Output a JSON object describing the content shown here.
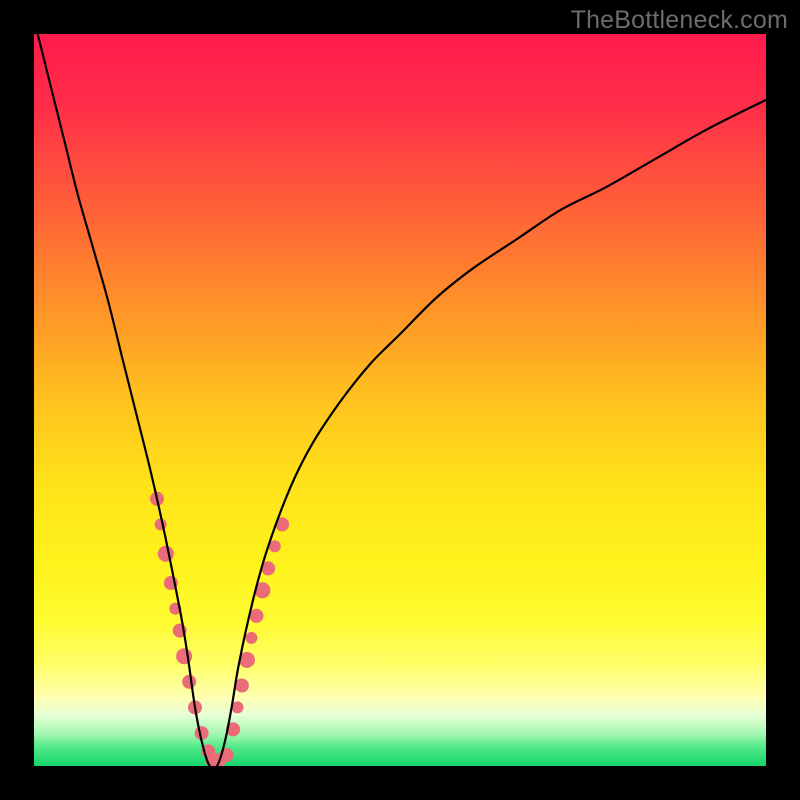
{
  "watermark": "TheBottleneck.com",
  "gradient": {
    "stops": [
      {
        "offset": 0.0,
        "color": "#ff1a4c"
      },
      {
        "offset": 0.1,
        "color": "#ff2e49"
      },
      {
        "offset": 0.22,
        "color": "#ff5a3a"
      },
      {
        "offset": 0.35,
        "color": "#ff8a2b"
      },
      {
        "offset": 0.5,
        "color": "#ffc21f"
      },
      {
        "offset": 0.62,
        "color": "#ffe41a"
      },
      {
        "offset": 0.72,
        "color": "#fff21c"
      },
      {
        "offset": 0.8,
        "color": "#fffb30"
      },
      {
        "offset": 0.86,
        "color": "#ffff66"
      },
      {
        "offset": 0.905,
        "color": "#ffffb0"
      },
      {
        "offset": 0.93,
        "color": "#e8ffd8"
      },
      {
        "offset": 0.955,
        "color": "#a8f8b2"
      },
      {
        "offset": 0.975,
        "color": "#4fe887"
      },
      {
        "offset": 1.0,
        "color": "#16d56a"
      }
    ]
  },
  "chart_data": {
    "type": "line",
    "title": "",
    "xlabel": "",
    "ylabel": "",
    "xlim": [
      0,
      100
    ],
    "ylim": [
      0,
      100
    ],
    "series": [
      {
        "name": "curve",
        "x": [
          0,
          2,
          4,
          6,
          8,
          10,
          12,
          14,
          16,
          18,
          20,
          21,
          22,
          23,
          24,
          25,
          26,
          27,
          28,
          30,
          32,
          35,
          38,
          42,
          46,
          50,
          55,
          60,
          66,
          72,
          78,
          85,
          92,
          100
        ],
        "y": [
          102,
          94,
          86,
          78,
          71,
          64,
          56,
          48,
          40,
          31,
          21,
          15,
          8,
          3,
          0,
          0,
          3,
          8,
          14,
          23,
          30,
          38,
          44,
          50,
          55,
          59,
          64,
          68,
          72,
          76,
          79,
          83,
          87,
          91
        ]
      }
    ],
    "dot_clusters": [
      {
        "name": "left-cluster",
        "color": "#ea6c78",
        "points": [
          {
            "x": 16.8,
            "y": 36.5,
            "r": 7
          },
          {
            "x": 17.3,
            "y": 33.0,
            "r": 6
          },
          {
            "x": 18.0,
            "y": 29.0,
            "r": 8
          },
          {
            "x": 18.7,
            "y": 25.0,
            "r": 7
          },
          {
            "x": 19.3,
            "y": 21.5,
            "r": 6
          },
          {
            "x": 19.9,
            "y": 18.5,
            "r": 7
          },
          {
            "x": 20.5,
            "y": 15.0,
            "r": 8
          },
          {
            "x": 21.2,
            "y": 11.5,
            "r": 7
          },
          {
            "x": 22.0,
            "y": 8.0,
            "r": 7
          },
          {
            "x": 22.9,
            "y": 4.5,
            "r": 7
          },
          {
            "x": 23.8,
            "y": 2.0,
            "r": 7
          }
        ]
      },
      {
        "name": "bottom-cluster",
        "color": "#ea6c78",
        "points": [
          {
            "x": 24.3,
            "y": 0.8,
            "r": 7
          },
          {
            "x": 25.3,
            "y": 0.8,
            "r": 7
          },
          {
            "x": 26.3,
            "y": 1.5,
            "r": 7
          }
        ]
      },
      {
        "name": "right-cluster",
        "color": "#ea6c78",
        "points": [
          {
            "x": 27.2,
            "y": 5.0,
            "r": 7
          },
          {
            "x": 27.8,
            "y": 8.0,
            "r": 6
          },
          {
            "x": 28.4,
            "y": 11.0,
            "r": 7
          },
          {
            "x": 29.1,
            "y": 14.5,
            "r": 8
          },
          {
            "x": 29.7,
            "y": 17.5,
            "r": 6
          },
          {
            "x": 30.4,
            "y": 20.5,
            "r": 7
          },
          {
            "x": 31.2,
            "y": 24.0,
            "r": 8
          },
          {
            "x": 32.0,
            "y": 27.0,
            "r": 7
          },
          {
            "x": 32.9,
            "y": 30.0,
            "r": 6
          },
          {
            "x": 33.9,
            "y": 33.0,
            "r": 7
          }
        ]
      }
    ]
  }
}
